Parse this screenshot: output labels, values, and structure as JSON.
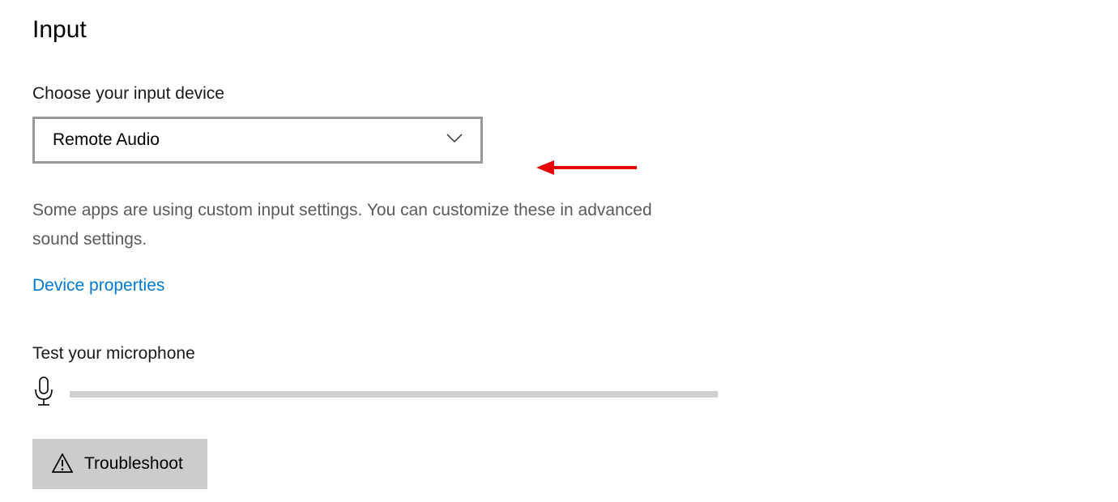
{
  "section": {
    "title": "Input"
  },
  "input_device": {
    "label": "Choose your input device",
    "selected": "Remote Audio"
  },
  "description": "Some apps are using custom input settings. You can customize these in advanced sound settings.",
  "link": {
    "device_properties": "Device properties"
  },
  "mic_test": {
    "label": "Test your microphone"
  },
  "troubleshoot": {
    "label": "Troubleshoot"
  }
}
